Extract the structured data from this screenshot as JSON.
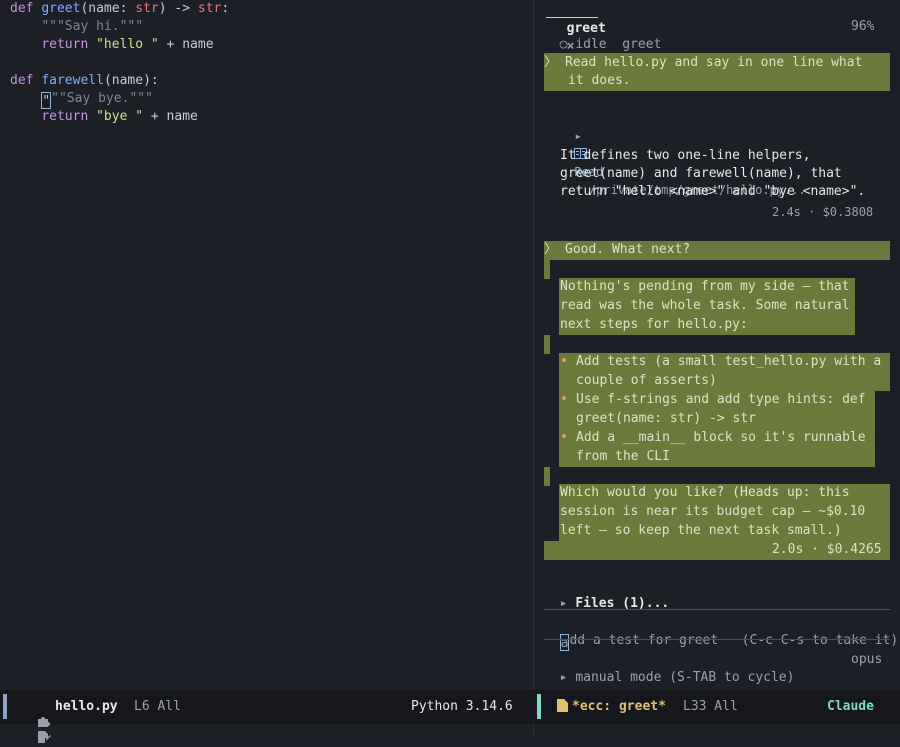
{
  "editor": {
    "code_lines": [
      {
        "parts": [
          {
            "t": "def ",
            "c": "kw"
          },
          {
            "t": "greet",
            "c": "fn"
          },
          {
            "t": "(name: ",
            "c": "op"
          },
          {
            "t": "str",
            "c": "ty"
          },
          {
            "t": ") -> ",
            "c": "op"
          },
          {
            "t": "str",
            "c": "ty"
          },
          {
            "t": ":",
            "c": "op"
          }
        ]
      },
      {
        "parts": [
          {
            "t": "    ",
            "c": "op"
          },
          {
            "t": "\"\"\"Say hi.\"\"\"",
            "c": "doc"
          }
        ]
      },
      {
        "parts": [
          {
            "t": "    ",
            "c": "op"
          },
          {
            "t": "return ",
            "c": "kw"
          },
          {
            "t": "\"hello \"",
            "c": "str"
          },
          {
            "t": " + name",
            "c": "op"
          }
        ]
      },
      {
        "parts": []
      },
      {
        "parts": [
          {
            "t": "def ",
            "c": "kw"
          },
          {
            "t": "farewell",
            "c": "fn"
          },
          {
            "t": "(name):",
            "c": "op"
          }
        ]
      },
      {
        "parts": [
          {
            "t": "    ",
            "c": "op"
          },
          {
            "t": "\"",
            "c": "cursor"
          },
          {
            "t": "\"\"Say bye.\"\"\"",
            "c": "doc"
          }
        ]
      },
      {
        "parts": [
          {
            "t": "    ",
            "c": "op"
          },
          {
            "t": "return ",
            "c": "kw"
          },
          {
            "t": "\"bye \"",
            "c": "str"
          },
          {
            "t": " + name",
            "c": "op"
          }
        ]
      }
    ]
  },
  "chat": {
    "tab_label": "greet",
    "tab_close": "×",
    "status": {
      "dot": "○",
      "state": "idle",
      "name": "greet",
      "percent": "96%"
    },
    "prompt1": {
      "marker": "〉",
      "line1": "Read hello.py and say in one line what",
      "line2": "it does."
    },
    "tool": {
      "arrow": "▸",
      "name": "Read",
      "path": "· /private/tmp/greet/hello.py..."
    },
    "reply1": {
      "lines": [
        "It defines two one-line helpers,",
        "greet(name) and farewell(name), that",
        "return \"hello <name>\" and \"bye <name>\"."
      ],
      "meta": "2.4s · $0.3808"
    },
    "prompt2": {
      "marker": "〉",
      "text": "Good. What next?"
    },
    "reply2": {
      "intro": [
        "Nothing's pending from my side — that",
        "read was the whole task. Some natural",
        "next steps for hello.py:"
      ],
      "bullets": [
        {
          "l1": "Add tests (a small test_hello.py with a",
          "l2": "couple of asserts)"
        },
        {
          "l1": "Use f-strings and add type hints: def",
          "l2": "greet(name: str) -> str"
        },
        {
          "l1": "Add a __main__ block so it's runnable",
          "l2": "from the CLI"
        }
      ],
      "bullet_char": "•",
      "outro": [
        "Which would you like? (Heads up: this",
        "session is near its budget cap — ~$0.10",
        "left — so keep the next task small.)"
      ],
      "meta": "2.0s · $0.4265"
    },
    "files": {
      "arrow": "▸",
      "label": "Files (1)..."
    },
    "input": {
      "cursor_char": "a",
      "placeholder": "dd a test for greet   (C-c C-s to take it)"
    },
    "mode": {
      "arrow": "▸",
      "label": "manual mode (S-TAB to cycle)",
      "model": "opus"
    }
  },
  "modeline": {
    "left": {
      "file": "hello.py",
      "position": "L6 All",
      "language": "Python 3.14.6"
    },
    "right": {
      "buffer": "*ecc: greet*",
      "position": "L33 All",
      "agent": "Claude"
    },
    "colors": {
      "left_bar": "#8fa3c9",
      "right_bar": "#7fd8c8",
      "buffer": "#e0c070"
    }
  }
}
